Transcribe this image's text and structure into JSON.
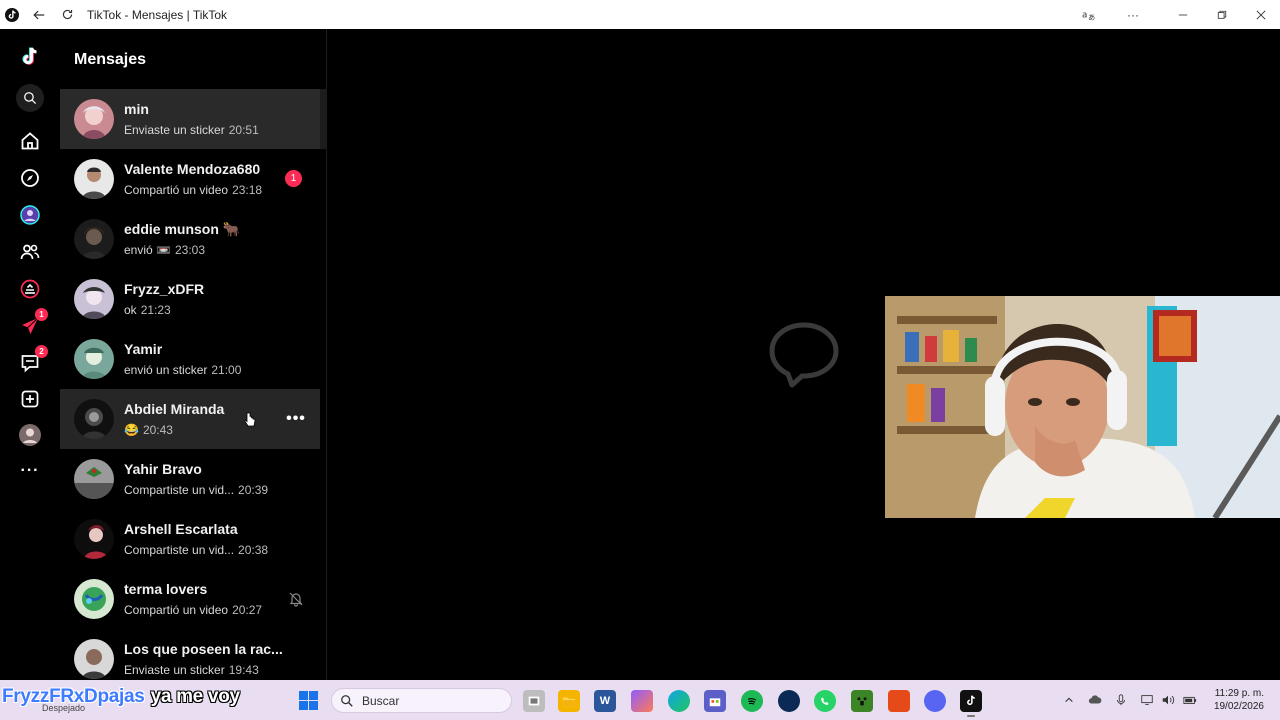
{
  "window": {
    "title": "TikTok - Mensajes | TikTok"
  },
  "panel": {
    "title": "Mensajes"
  },
  "rail": {
    "badges": {
      "activity": "1",
      "inbox": "2"
    }
  },
  "conversations": [
    {
      "name": "min",
      "preview": "Enviaste un sticker",
      "time": "20:51",
      "state": "active"
    },
    {
      "name": "Valente Mendoza680",
      "preview": "Compartió un video",
      "time": "23:18",
      "unread": "1"
    },
    {
      "name": "eddie munson 🐂",
      "preview": "envió 📼",
      "time": "23:03"
    },
    {
      "name": "Fryzz_xDFR",
      "preview": "ok",
      "time": "21:23"
    },
    {
      "name": "Yamir",
      "preview": "envió un sticker",
      "time": "21:00"
    },
    {
      "name": "Abdiel Miranda",
      "preview": "😂",
      "time": "20:43",
      "state": "hover",
      "more": "•••"
    },
    {
      "name": "Yahir Bravo",
      "preview": "Compartiste un vid...",
      "time": "20:39"
    },
    {
      "name": "Arshell Escarlata",
      "preview": "Compartiste un vid...",
      "time": "20:38"
    },
    {
      "name": "terma lovers",
      "preview": "Compartió un video",
      "time": "20:27",
      "muted": true
    },
    {
      "name": "Los que poseen la rac...",
      "preview": "Enviaste un sticker",
      "time": "19:43"
    }
  ],
  "overlay": {
    "username": "FryzzFRxDpajas",
    "message": "ya me voy"
  },
  "taskbar": {
    "weather": "Despejado",
    "search_placeholder": "Buscar",
    "time": "11:29 p. m.",
    "date": "19/02/2026"
  },
  "colors": {
    "accent": "#fe2c55",
    "background": "#000000",
    "taskbar": "#e8ddf1"
  }
}
